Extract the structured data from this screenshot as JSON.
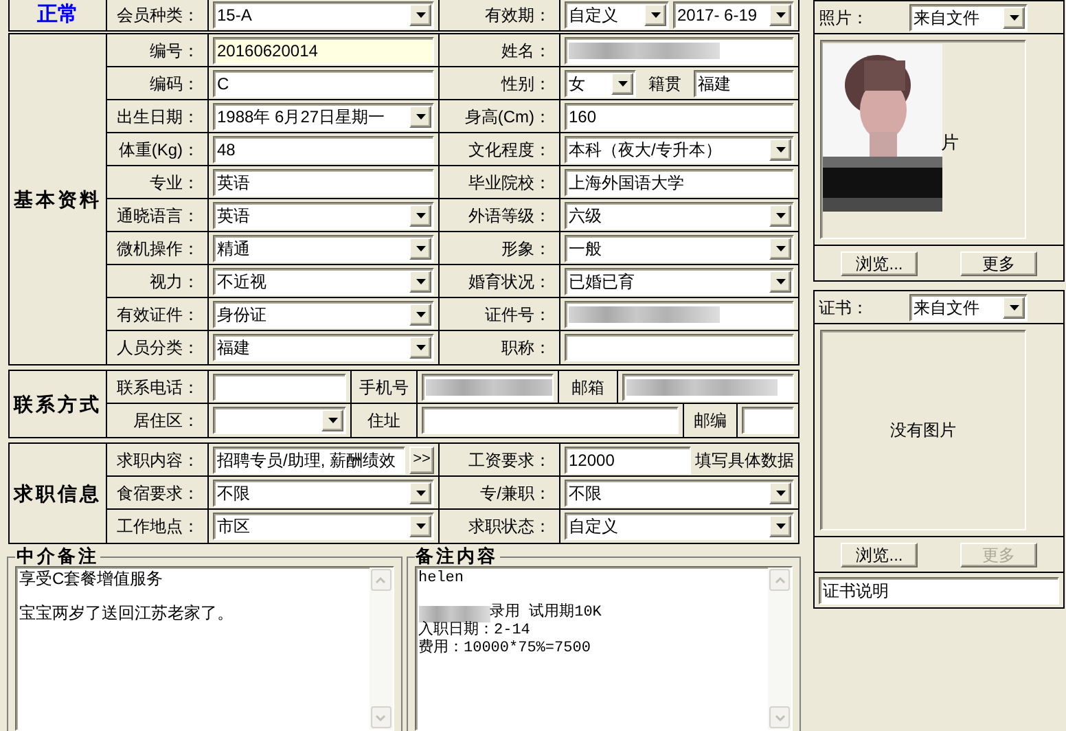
{
  "status": "正常",
  "header": {
    "left": {
      "label": "会员种类：",
      "kind": "select",
      "value": "15-A"
    },
    "right": {
      "label": "有效期：",
      "kind": "select_with_date",
      "value": "自定义",
      "date": "2017- 6-19"
    }
  },
  "basic": {
    "title": "基本资料",
    "rows": [
      {
        "left": {
          "label": "编号：",
          "kind": "text",
          "value": "20160620014",
          "highlighted": true
        },
        "right": {
          "label": "姓名：",
          "kind": "text",
          "redacted": true
        }
      },
      {
        "left": {
          "label": "编码：",
          "kind": "text",
          "value": "C"
        },
        "right": {
          "label": "性别：",
          "kind": "select_with_origin",
          "value": "女",
          "origin_label": "籍贯",
          "origin_value": "福建"
        }
      },
      {
        "left": {
          "label": "出生日期：",
          "kind": "select",
          "value": "1988年 6月27日星期一"
        },
        "right": {
          "label": "身高(Cm)：",
          "kind": "text",
          "value": "160"
        }
      },
      {
        "left": {
          "label": "体重(Kg)：",
          "kind": "text",
          "value": "48"
        },
        "right": {
          "label": "文化程度：",
          "kind": "select",
          "value": "本科（夜大/专升本）"
        }
      },
      {
        "left": {
          "label": "专业：",
          "kind": "text",
          "value": "英语"
        },
        "right": {
          "label": "毕业院校：",
          "kind": "text",
          "value": "上海外国语大学"
        }
      },
      {
        "left": {
          "label": "通晓语言：",
          "kind": "select",
          "value": "英语"
        },
        "right": {
          "label": "外语等级：",
          "kind": "select",
          "value": "六级"
        }
      },
      {
        "left": {
          "label": "微机操作：",
          "kind": "select",
          "value": "精通"
        },
        "right": {
          "label": "形象：",
          "kind": "select",
          "value": "一般"
        }
      },
      {
        "left": {
          "label": "视力：",
          "kind": "select",
          "value": "不近视"
        },
        "right": {
          "label": "婚育状况：",
          "kind": "select",
          "value": "已婚已育"
        }
      },
      {
        "left": {
          "label": "有效证件：",
          "kind": "select",
          "value": "身份证"
        },
        "right": {
          "label": "证件号：",
          "kind": "text",
          "redacted": true
        }
      },
      {
        "left": {
          "label": "人员分类：",
          "kind": "select",
          "value": "福建"
        },
        "right": {
          "label": "职称：",
          "kind": "text"
        }
      }
    ]
  },
  "contact": {
    "title": "联系方式",
    "rows": [
      [
        {
          "label": "联系电话：",
          "kind": "text"
        },
        {
          "label": "手机号",
          "kind": "text",
          "redacted": true
        },
        {
          "label": "邮箱",
          "kind": "text",
          "redacted": true
        }
      ],
      [
        {
          "label": "居住区：",
          "kind": "select"
        },
        {
          "label": "住址",
          "kind": "text"
        },
        {
          "label": "邮编",
          "kind": "text"
        }
      ]
    ]
  },
  "job": {
    "title": "求职信息",
    "rows": [
      {
        "left": {
          "label": "求职内容：",
          "kind": "text_with_button",
          "value": "招聘专员/助理, 薪酬绩效",
          "button": ">>"
        },
        "right": {
          "label": "工资要求：",
          "kind": "text_with_hint",
          "value": "12000",
          "hint": "填写具体数据"
        }
      },
      {
        "left": {
          "label": "食宿要求：",
          "kind": "select",
          "value": "不限"
        },
        "right": {
          "label": "专/兼职：",
          "kind": "select",
          "value": "不限"
        }
      },
      {
        "left": {
          "label": "工作地点：",
          "kind": "select",
          "value": "市区"
        },
        "right": {
          "label": "求职状态：",
          "kind": "select",
          "value": "自定义"
        }
      }
    ]
  },
  "memos": [
    {
      "title": "中介备注",
      "mono": false,
      "paragraphs": [
        {
          "lines": [
            {
              "text": "享受C套餐增值服务",
              "redacted_prefix": false
            }
          ]
        },
        {
          "lines": [
            {
              "text": "宝宝两岁了送回江苏老家了。",
              "redacted_prefix": false
            }
          ]
        }
      ]
    },
    {
      "title": "备注内容",
      "mono": true,
      "paragraphs": [
        {
          "lines": [
            {
              "text": "helen",
              "redacted_prefix": false
            }
          ]
        },
        {
          "lines": [
            {
              "text": "录用 试用期10K",
              "redacted_prefix": true
            },
            {
              "text": "入职日期：2-14",
              "redacted_prefix": false
            },
            {
              "text": "费用：10000*75%=7500",
              "redacted_prefix": false
            }
          ]
        }
      ]
    }
  ],
  "photo": {
    "label": "照片：",
    "source": "来自文件",
    "caption": "片",
    "has_picture": true,
    "buttons": [
      {
        "label": "浏览...",
        "disabled": false
      },
      {
        "label": "更多",
        "disabled": false
      }
    ]
  },
  "certificate": {
    "label": "证书：",
    "source": "来自文件",
    "caption": "没有图片",
    "has_picture": false,
    "buttons": [
      {
        "label": "浏览...",
        "disabled": false
      },
      {
        "label": "更多",
        "disabled": true
      }
    ],
    "description": "证书说明"
  }
}
